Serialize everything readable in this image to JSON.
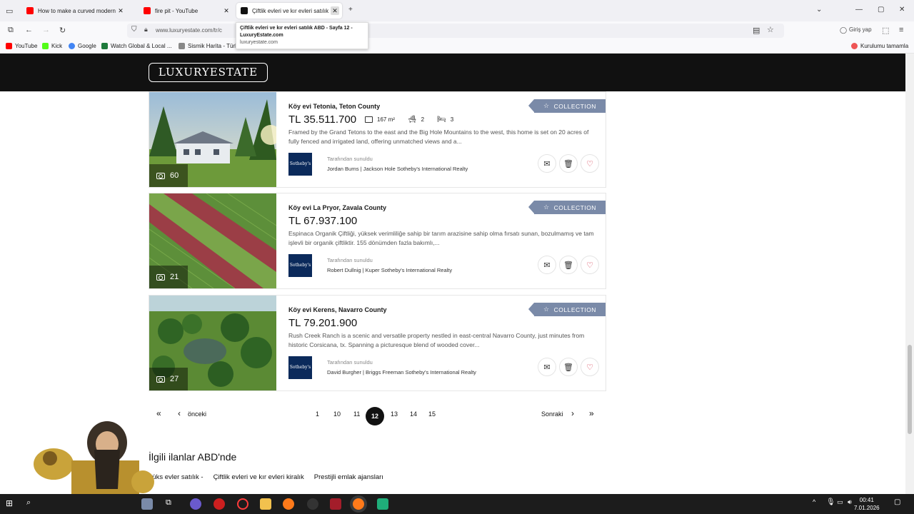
{
  "browser": {
    "tabs": [
      {
        "title": "How to make a curved modern",
        "favicon_color": "#ff0000"
      },
      {
        "title": "fire pit - YouTube",
        "favicon_color": "#ff0000"
      },
      {
        "title": "Çiftlik evleri ve kır evleri satılık",
        "favicon_color": "#111111"
      }
    ],
    "url": "www.luxuryestate.com/tr/c",
    "tooltip": {
      "title": "Çiftlik evleri ve kır evleri satılık ABD - Sayfa 12 - LuxuryEstate.com",
      "domain": "luxuryestate.com"
    },
    "signin_label": "Giriş yap",
    "bookmarks": [
      {
        "label": "YouTube",
        "color": "#ff0000"
      },
      {
        "label": "Kick",
        "color": "#53fc18"
      },
      {
        "label": "Google",
        "color": "#4285f4"
      },
      {
        "label": "Watch Global & Local ...",
        "color": "#1e7a3b"
      },
      {
        "label": "Sismik Harita - Türk...",
        "color": "#888888"
      }
    ],
    "bookmark_right": "Kurulumu tamamla"
  },
  "site": {
    "logo": "LUXURYESTATE"
  },
  "listings": [
    {
      "title": "Köy evi Tetonia, Teton County",
      "price": "TL 35.511.700",
      "area": "167 m²",
      "baths": "2",
      "beds": "3",
      "description": "Framed by the Grand Tetons to the east and the Big Hole Mountains to the west, this home is set on 20 acres of fully fenced and irrigated land, offering unmatched views and a...",
      "offered_by": "Tarafından sunuldu",
      "agent": "Jordan Burns | Jackson Hole Sotheby's International Realty",
      "photos": "60",
      "badge": "COLLECTION",
      "agency_logo": "Sotheby's"
    },
    {
      "title": "Köy evi La Pryor, Zavala County",
      "price": "TL 67.937.100",
      "description": "Espinaca Organik Çiftliği, yüksek verimliliğe sahip bir tarım arazisine sahip olma fırsatı sunan, bozulmamış ve tam işlevli bir organik çiftliktir. 155 dönümden fazla bakımlı,...",
      "offered_by": "Tarafından sunuldu",
      "agent": "Robert Dullnig | Kuper Sotheby's International Realty",
      "photos": "21",
      "badge": "COLLECTION",
      "agency_logo": "Sotheby's"
    },
    {
      "title": "Köy evi Kerens, Navarro County",
      "price": "TL 79.201.900",
      "description": "Rush Creek Ranch is a scenic and versatile property nestled in east-central Navarro County, just minutes from historic Corsicana, tx. Spanning a picturesque blend of wooded cover...",
      "offered_by": "Tarafından sunuldu",
      "agent": "David Burgher | Briggs Freeman Sotheby's International Realty",
      "photos": "27",
      "badge": "COLLECTION",
      "agency_logo": "Sotheby's"
    }
  ],
  "pagination": {
    "prev": "önceki",
    "next": "Sonraki",
    "pages": [
      "1",
      "10",
      "11",
      "12",
      "13",
      "14",
      "15"
    ],
    "current": "12"
  },
  "related": {
    "heading": "İlgili ilanlar ABD'nde",
    "links": [
      "Lüks evler satılık -",
      "Çiftlik evleri ve kır evleri kiralık",
      "Prestijli emlak ajansları"
    ]
  },
  "taskbar": {
    "time": "00:41",
    "date": "7.01.2026"
  }
}
